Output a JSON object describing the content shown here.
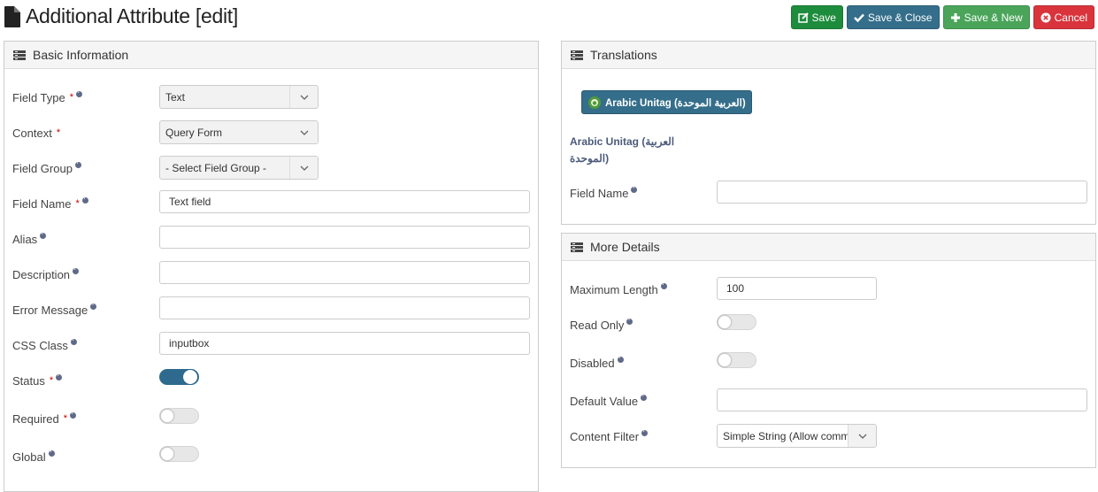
{
  "page": {
    "title": "Additional Attribute [edit]"
  },
  "toolbar": {
    "save": {
      "label": "Save",
      "color": "#1e8c3d"
    },
    "save_close": {
      "label": "Save & Close",
      "color": "#346e8a"
    },
    "save_new": {
      "label": "Save & New",
      "color": "#4aa55a"
    },
    "cancel": {
      "label": "Cancel",
      "color": "#d9343c"
    }
  },
  "basic": {
    "heading": "Basic Information",
    "field_type": {
      "label": "Field Type",
      "value": "Text"
    },
    "context": {
      "label": "Context",
      "value": "Query Form"
    },
    "field_group": {
      "label": "Field Group",
      "value": "- Select Field Group -"
    },
    "field_name": {
      "label": "Field Name",
      "value": "Text field"
    },
    "alias": {
      "label": "Alias",
      "value": ""
    },
    "description": {
      "label": "Description",
      "value": ""
    },
    "error_message": {
      "label": "Error Message",
      "value": ""
    },
    "css_class": {
      "label": "CSS Class",
      "value": "inputbox"
    },
    "status": {
      "label": "Status",
      "on": true
    },
    "required": {
      "label": "Required",
      "on": false
    },
    "global": {
      "label": "Global",
      "on": false
    },
    "required_marker": "*"
  },
  "translations": {
    "heading": "Translations",
    "language_button": "Arabic Unitag (العربية الموحدة)",
    "language_heading_line1": "Arabic Unitag (العربية",
    "language_heading_line2": "الموحدة)",
    "field_name": {
      "label": "Field Name",
      "value": ""
    }
  },
  "more": {
    "heading": "More Details",
    "max_length": {
      "label": "Maximum Length",
      "value": "100"
    },
    "read_only": {
      "label": "Read Only",
      "on": false
    },
    "disabled": {
      "label": "Disabled",
      "on": false
    },
    "default_value": {
      "label": "Default Value",
      "value": ""
    },
    "content_filter": {
      "label": "Content Filter",
      "value": "Simple String (Allow common"
    }
  }
}
